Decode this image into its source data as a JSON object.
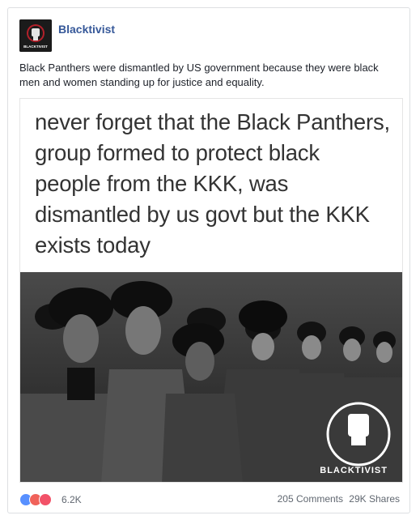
{
  "post": {
    "page_name": "Blacktivist",
    "avatar_label": "BLACKTIVIST",
    "caption": "Black Panthers were dismantled by US government because they were black men and women standing up for justice and equality."
  },
  "meme": {
    "text": "never forget that the Black Panthers, group formed to protect black people from the KKK, was dismantled by us govt but the KKK exists today",
    "watermark": "BLACKTIVIST"
  },
  "footer": {
    "reaction_count": "6.2K",
    "comments": "205 Comments",
    "shares": "29K Shares",
    "reactions": [
      "like-icon",
      "angry-icon",
      "love-icon"
    ],
    "colors": {
      "like": "#5890ff",
      "angry": "#f0625a",
      "love": "#f25268"
    }
  }
}
